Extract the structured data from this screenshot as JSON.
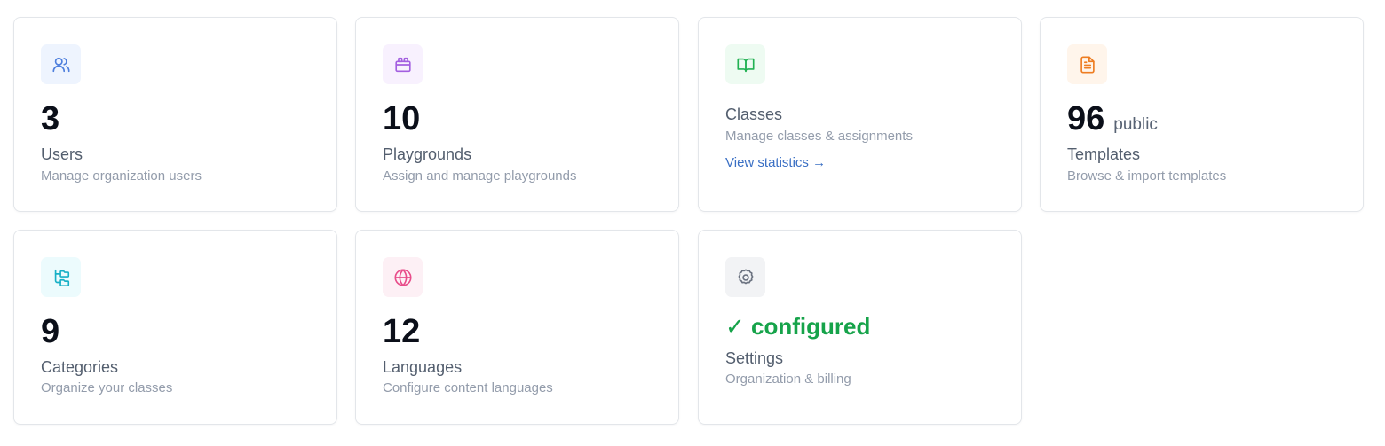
{
  "colors": {
    "blue": "#4e7fdd",
    "blue_bg": "#eef4fe",
    "purple": "#a35fe0",
    "purple_bg": "#f8f1fe",
    "green": "#22b153",
    "green_bg": "#eefbf2",
    "orange": "#ee7d22",
    "orange_bg": "#fff5eb",
    "cyan": "#18b0c6",
    "cyan_bg": "#ecfbfd",
    "pink": "#e84d8a",
    "pink_bg": "#fdf0f5",
    "gray": "#6b7280",
    "gray_bg": "#f2f3f5",
    "status_green": "#16a34a",
    "link_blue": "#3a6fc4"
  },
  "cards": {
    "users": {
      "icon": "users-icon",
      "value": "3",
      "title": "Users",
      "description": "Manage organization users"
    },
    "playgrounds": {
      "icon": "playground-icon",
      "value": "10",
      "title": "Playgrounds",
      "description": "Assign and manage playgrounds"
    },
    "classes": {
      "icon": "book-open-icon",
      "title": "Classes",
      "description": "Manage classes & assignments",
      "link": "View statistics →"
    },
    "templates": {
      "icon": "file-text-icon",
      "value": "96",
      "value_suffix": "public",
      "title": "Templates",
      "description": "Browse & import templates"
    },
    "categories": {
      "icon": "folder-tree-icon",
      "value": "9",
      "title": "Categories",
      "description": "Organize your classes"
    },
    "languages": {
      "icon": "globe-icon",
      "value": "12",
      "title": "Languages",
      "description": "Configure content languages"
    },
    "settings": {
      "icon": "gear-icon",
      "status": "✓ configured",
      "title": "Settings",
      "description": "Organization & billing"
    }
  }
}
